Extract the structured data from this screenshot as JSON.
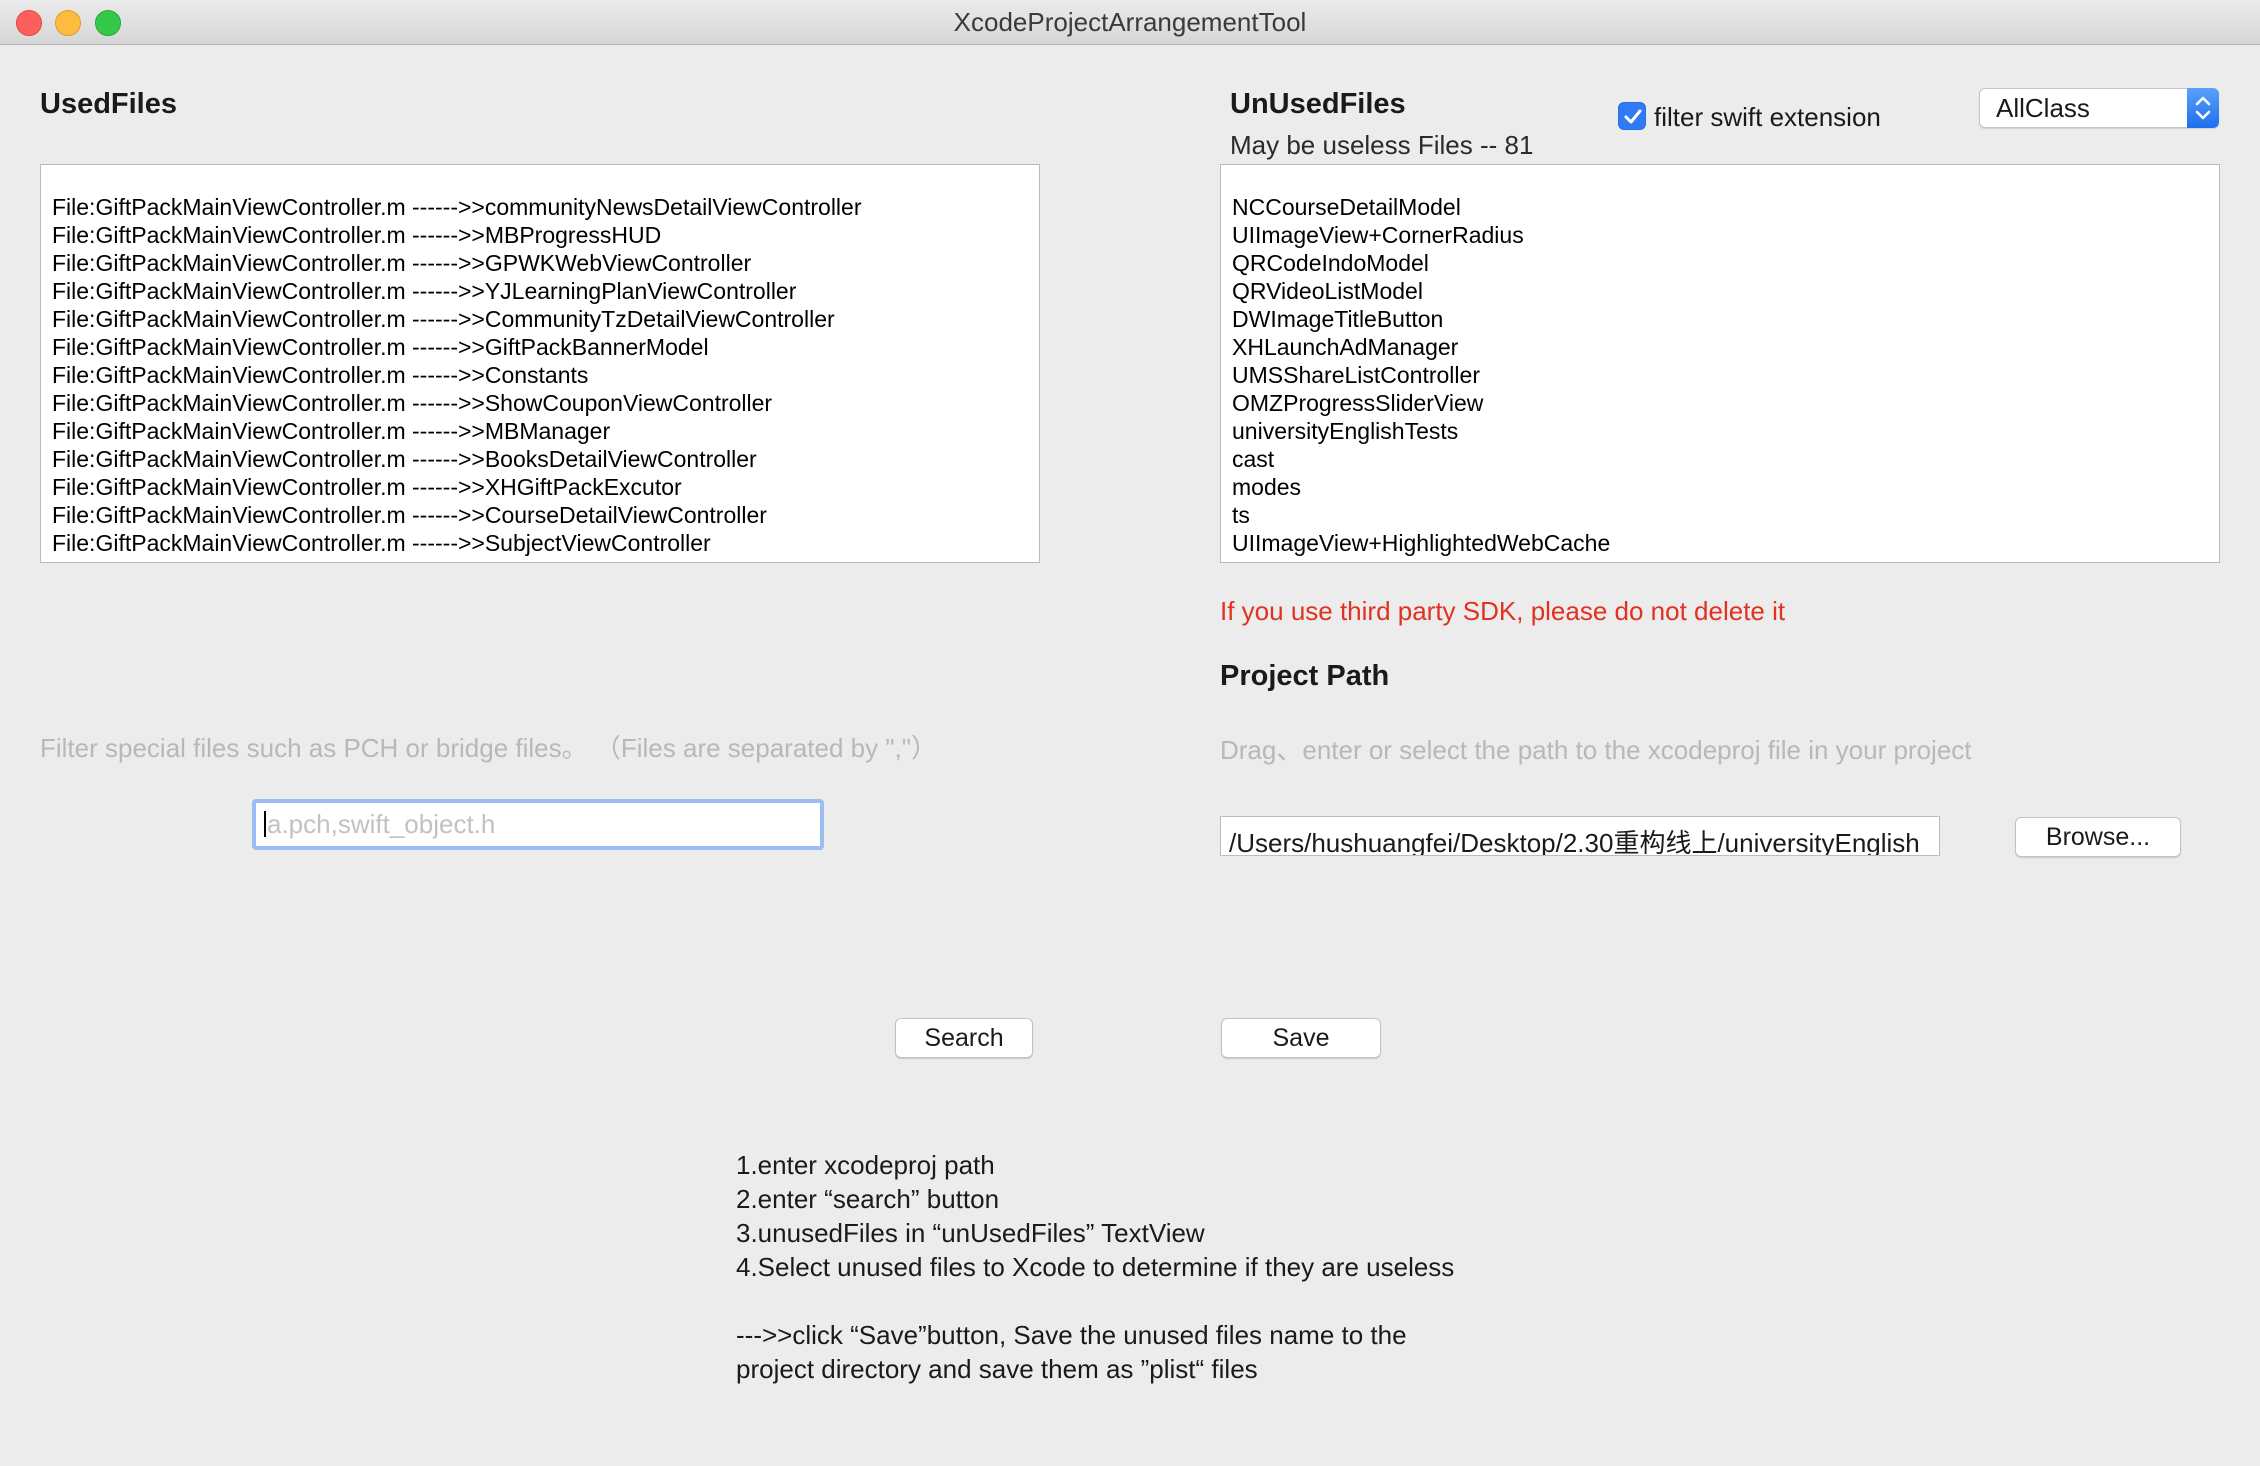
{
  "window": {
    "title": "XcodeProjectArrangementTool"
  },
  "used": {
    "heading": "UsedFiles",
    "lines": [
      "File:GiftPackMainViewController.m ------>>communityNewsDetailViewController",
      "File:GiftPackMainViewController.m ------>>MBProgressHUD",
      "File:GiftPackMainViewController.m ------>>GPWKWebViewController",
      "File:GiftPackMainViewController.m ------>>YJLearningPlanViewController",
      "File:GiftPackMainViewController.m ------>>CommunityTzDetailViewController",
      "File:GiftPackMainViewController.m ------>>GiftPackBannerModel",
      "File:GiftPackMainViewController.m ------>>Constants",
      "File:GiftPackMainViewController.m ------>>ShowCouponViewController",
      "File:GiftPackMainViewController.m ------>>MBManager",
      "File:GiftPackMainViewController.m ------>>BooksDetailViewController",
      "File:GiftPackMainViewController.m ------>>XHGiftPackExcutor",
      "File:GiftPackMainViewController.m ------>>CourseDetailViewController",
      "File:GiftPackMainViewController.m ------>>SubjectViewController"
    ]
  },
  "unused": {
    "heading": "UnUsedFiles",
    "subheading": "May be useless Files -- 81",
    "filter_label": "filter swift  extension",
    "filter_checked": true,
    "class_select": "AllClass",
    "lines": [
      "NCCourseDetailModel",
      "UIImageView+CornerRadius",
      "QRCodeIndoModel",
      "QRVideoListModel",
      "DWImageTitleButton",
      "XHLaunchAdManager",
      "UMSShareListController",
      "OMZProgressSliderView",
      "universityEnglishTests",
      "cast",
      "modes",
      "ts",
      "UIImageView+HighlightedWebCache"
    ],
    "warning": "If you use third party SDK, please do not delete it",
    "warning_color": "#e0321f"
  },
  "filter": {
    "hint": "Filter special files such as PCH or bridge files。 （Files are separated by \",\"）",
    "placeholder": "a.pch,swift_object.h"
  },
  "project": {
    "heading": "Project Path",
    "hint": "Drag、enter or select the path to the xcodeproj file in your project",
    "path_value": "/Users/hushuangfei/Desktop/2.30重构线上/universityEnglish",
    "browse_label": "Browse..."
  },
  "actions": {
    "search_label": "Search",
    "save_label": "Save"
  },
  "instructions": {
    "lines": [
      "1.enter xcodeproj path",
      "2.enter “search” button",
      "3.unusedFiles in “unUsedFiles” TextView",
      "4.Select unused files to Xcode to determine if they are useless",
      "",
      " --->>click “Save”button, Save the unused files name to the",
      "project directory and save them as ”plist“ files"
    ]
  }
}
